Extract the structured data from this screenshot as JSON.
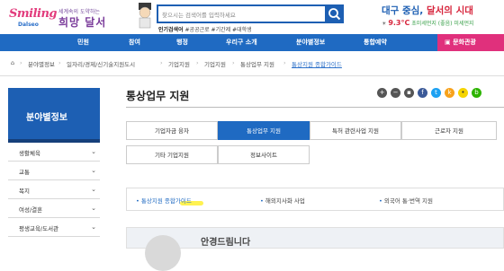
{
  "header": {
    "logo_en": "Smiling",
    "logo_en2": "Dalseo",
    "logo_kr_small": "세계속의 도약하는",
    "logo_kr_big": "희망 달서",
    "search_placeholder": "찾으시는 검색어를 입력하세요",
    "popular_label": "인기검색어",
    "popular_terms": "#공공근로 #기간제 #대학생",
    "slogan_blue": "대구 중심,",
    "slogan_red": "달서의 시대",
    "temperature": "9.3°C",
    "weather_text": "초미세먼지 (좋음) 미세먼지"
  },
  "nav": {
    "items": [
      "민원",
      "참여",
      "행정",
      "우리구 소개",
      "분야별정보",
      "통합예약"
    ],
    "culture": "문화관광"
  },
  "breadcrumb": [
    "분야별정보",
    "일자리/경제/신기술지원도시",
    "기업지원",
    "기업지원",
    "통상업무 지원",
    "통상지원 종합가이드"
  ],
  "sidebar": {
    "title": "분야별정보",
    "items": [
      "생활체육",
      "교통",
      "복지",
      "여성/결혼",
      "평생교육/도서관"
    ]
  },
  "main": {
    "title": "통상업무 지원",
    "tabs": [
      "기업자금 융자",
      "통상업무 지원",
      "특허 관련사업 지원",
      "근로자 지원",
      "기타 기업지원",
      "정보사이트"
    ],
    "links": [
      "통상지원 종합가이드",
      "해외지사화 사업",
      "외국어 통·번역 지원"
    ],
    "sub_title": "안경드림니다"
  },
  "colors": {
    "brand_blue": "#1f6ac2",
    "culture_pink": "#e0307c",
    "highlight_yellow": "#fff033"
  }
}
